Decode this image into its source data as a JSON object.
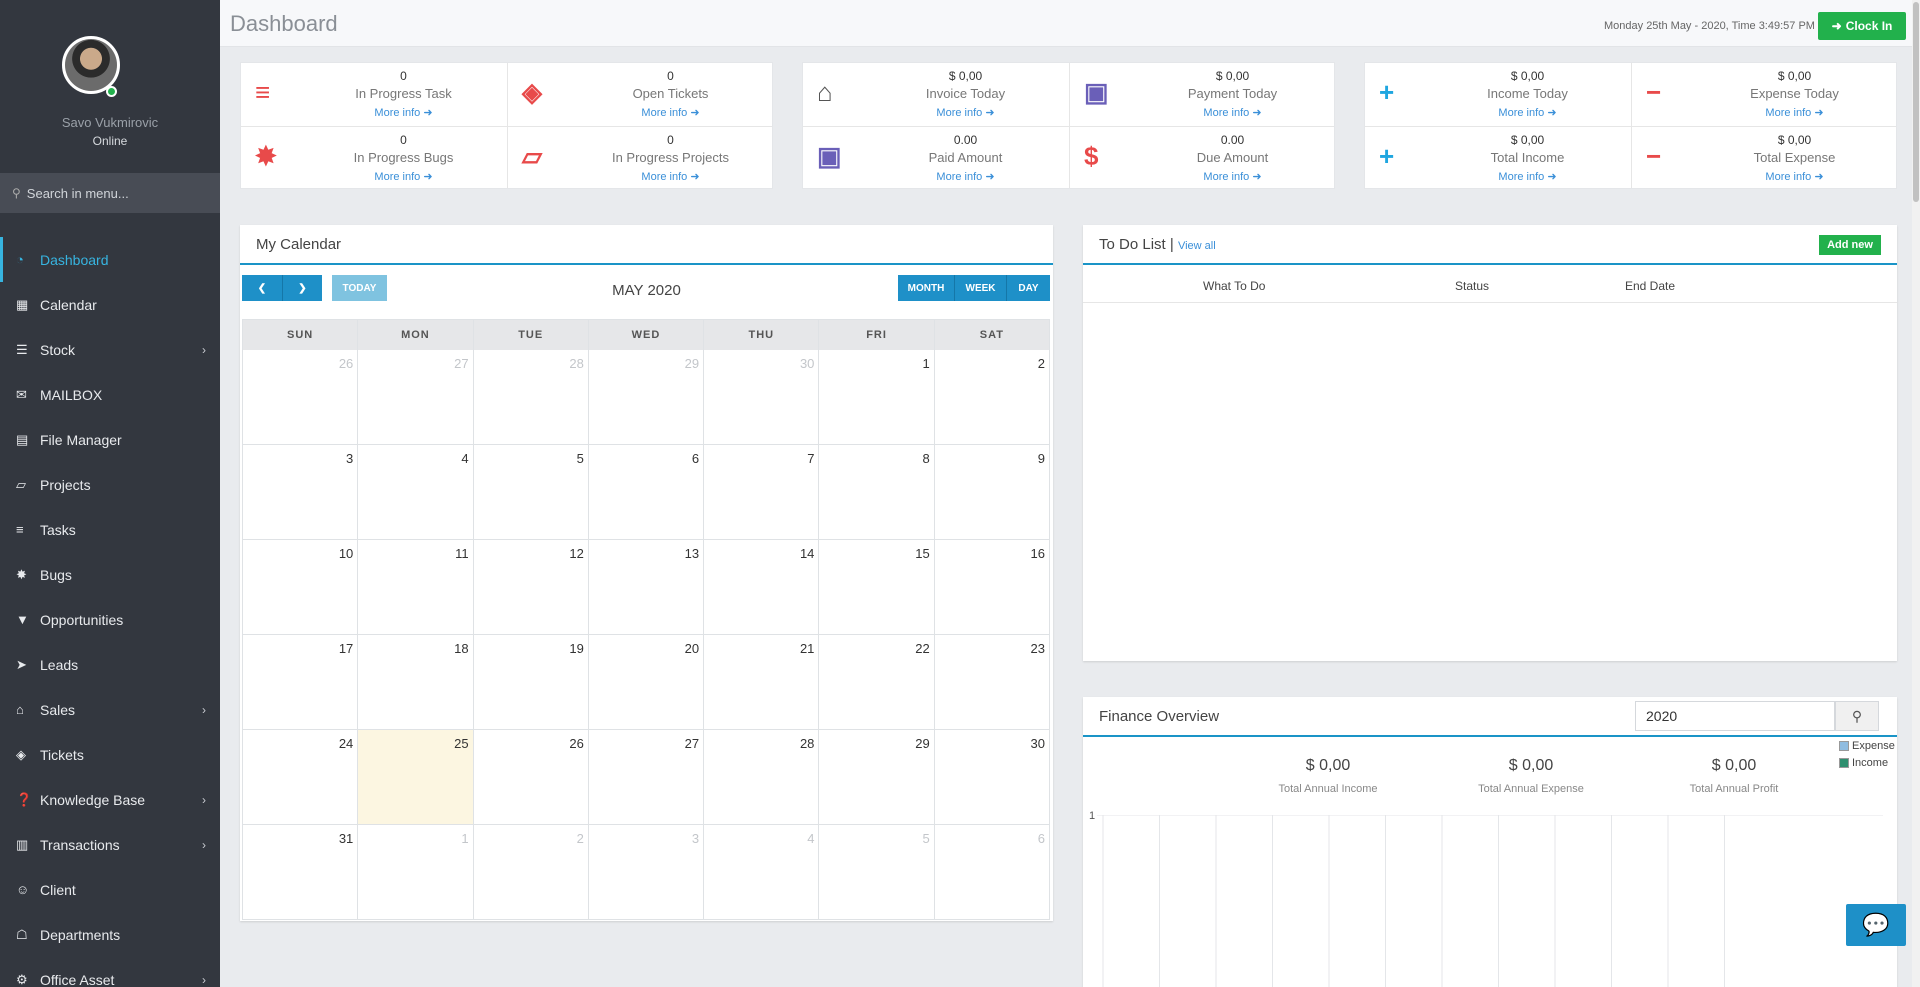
{
  "user": {
    "name": "Savo Vukmirovic",
    "status": "Online"
  },
  "sidebar": {
    "search_placeholder": "Search in menu...",
    "items": [
      {
        "label": "Dashboard",
        "icon": "dashboard-icon",
        "active": true,
        "submenu": false
      },
      {
        "label": "Calendar",
        "icon": "calendar-icon",
        "submenu": false
      },
      {
        "label": "Stock",
        "icon": "layers-icon",
        "submenu": true
      },
      {
        "label": "MAILBOX",
        "icon": "envelope-icon",
        "submenu": false
      },
      {
        "label": "File Manager",
        "icon": "file-icon",
        "submenu": false
      },
      {
        "label": "Projects",
        "icon": "folder-open-icon",
        "submenu": false
      },
      {
        "label": "Tasks",
        "icon": "tasks-icon",
        "submenu": false
      },
      {
        "label": "Bugs",
        "icon": "bug-icon",
        "submenu": false
      },
      {
        "label": "Opportunities",
        "icon": "filter-icon",
        "submenu": false
      },
      {
        "label": "Leads",
        "icon": "rocket-icon",
        "submenu": false
      },
      {
        "label": "Sales",
        "icon": "cart-icon",
        "submenu": true
      },
      {
        "label": "Tickets",
        "icon": "ticket-icon",
        "submenu": false
      },
      {
        "label": "Knowledge Base",
        "icon": "question-icon",
        "submenu": true
      },
      {
        "label": "Transactions",
        "icon": "building-icon",
        "submenu": true
      },
      {
        "label": "Client",
        "icon": "users-icon",
        "submenu": false
      },
      {
        "label": "Departments",
        "icon": "department-icon",
        "submenu": false
      },
      {
        "label": "Office Asset",
        "icon": "asset-icon",
        "submenu": true
      }
    ]
  },
  "header": {
    "title": "Dashboard",
    "datetime": "Monday 25th May - 2020,  Time  3:49:57 PM",
    "clock_in": "Clock In"
  },
  "stats": {
    "more_label": "More info",
    "panels": [
      [
        {
          "value": "0",
          "label": "In Progress Task",
          "icon": "tasks-icon",
          "color": "#e84a4a"
        },
        {
          "value": "0",
          "label": "Open Tickets",
          "icon": "ticket-icon",
          "color": "#e84a4a"
        },
        {
          "value": "0",
          "label": "In Progress Bugs",
          "icon": "bug-icon",
          "color": "#e84a4a"
        },
        {
          "value": "0",
          "label": "In Progress Projects",
          "icon": "folder-open-icon",
          "color": "#e84a4a"
        }
      ],
      [
        {
          "value": "$ 0,00",
          "label": "Invoice Today",
          "icon": "cart-icon",
          "color": "#555555"
        },
        {
          "value": "$ 0,00",
          "label": "Payment Today",
          "icon": "money-icon",
          "color": "#6a5fb8"
        },
        {
          "value": "0.00",
          "label": "Paid Amount",
          "icon": "money-icon",
          "color": "#6a5fb8"
        },
        {
          "value": "0.00",
          "label": "Due Amount",
          "icon": "dollar-icon",
          "color": "#e84a4a"
        }
      ],
      [
        {
          "value": "$ 0,00",
          "label": "Income Today",
          "icon": "plus-icon",
          "color": "#1fa6e0"
        },
        {
          "value": "$ 0,00",
          "label": "Expense Today",
          "icon": "minus-icon",
          "color": "#e84a4a"
        },
        {
          "value": "$ 0,00",
          "label": "Total Income",
          "icon": "plus-icon",
          "color": "#1fa6e0"
        },
        {
          "value": "$ 0,00",
          "label": "Total Expense",
          "icon": "minus-icon",
          "color": "#e84a4a"
        }
      ]
    ]
  },
  "calendar": {
    "title": "My Calendar",
    "today_label": "TODAY",
    "month_label": "MAY 2020",
    "views": [
      "MONTH",
      "WEEK",
      "DAY"
    ],
    "weekdays": [
      "SUN",
      "MON",
      "TUE",
      "WED",
      "THU",
      "FRI",
      "SAT"
    ],
    "weeks": [
      [
        {
          "d": "26",
          "o": 1
        },
        {
          "d": "27",
          "o": 1
        },
        {
          "d": "28",
          "o": 1
        },
        {
          "d": "29",
          "o": 1
        },
        {
          "d": "30",
          "o": 1
        },
        {
          "d": "1"
        },
        {
          "d": "2"
        }
      ],
      [
        {
          "d": "3"
        },
        {
          "d": "4"
        },
        {
          "d": "5"
        },
        {
          "d": "6"
        },
        {
          "d": "7"
        },
        {
          "d": "8"
        },
        {
          "d": "9"
        }
      ],
      [
        {
          "d": "10"
        },
        {
          "d": "11"
        },
        {
          "d": "12"
        },
        {
          "d": "13"
        },
        {
          "d": "14"
        },
        {
          "d": "15"
        },
        {
          "d": "16"
        }
      ],
      [
        {
          "d": "17"
        },
        {
          "d": "18"
        },
        {
          "d": "19"
        },
        {
          "d": "20"
        },
        {
          "d": "21"
        },
        {
          "d": "22"
        },
        {
          "d": "23"
        }
      ],
      [
        {
          "d": "24"
        },
        {
          "d": "25",
          "t": 1
        },
        {
          "d": "26"
        },
        {
          "d": "27"
        },
        {
          "d": "28"
        },
        {
          "d": "29"
        },
        {
          "d": "30"
        }
      ],
      [
        {
          "d": "31"
        },
        {
          "d": "1",
          "o": 1
        },
        {
          "d": "2",
          "o": 1
        },
        {
          "d": "3",
          "o": 1
        },
        {
          "d": "4",
          "o": 1
        },
        {
          "d": "5",
          "o": 1
        },
        {
          "d": "6",
          "o": 1
        }
      ]
    ]
  },
  "todo": {
    "title": "To Do List",
    "separator": "|",
    "view_all": "View all",
    "add_new": "Add new",
    "columns": [
      "What To Do",
      "Status",
      "End Date"
    ]
  },
  "finance": {
    "title": "Finance Overview",
    "year": "2020",
    "summary": [
      {
        "amount": "$ 0,00",
        "label": "Total Annual Income"
      },
      {
        "amount": "$ 0,00",
        "label": "Total Annual Expense"
      },
      {
        "amount": "$ 0,00",
        "label": "Total Annual Profit"
      }
    ],
    "legend": [
      {
        "name": "Expense",
        "color": "#8fbce0"
      },
      {
        "name": "Income",
        "color": "#2f8f6f"
      }
    ],
    "y_tick": "1"
  },
  "colors": {
    "accent": "#1a94c7",
    "success": "#22b14c",
    "sidebar": "#33373f"
  }
}
